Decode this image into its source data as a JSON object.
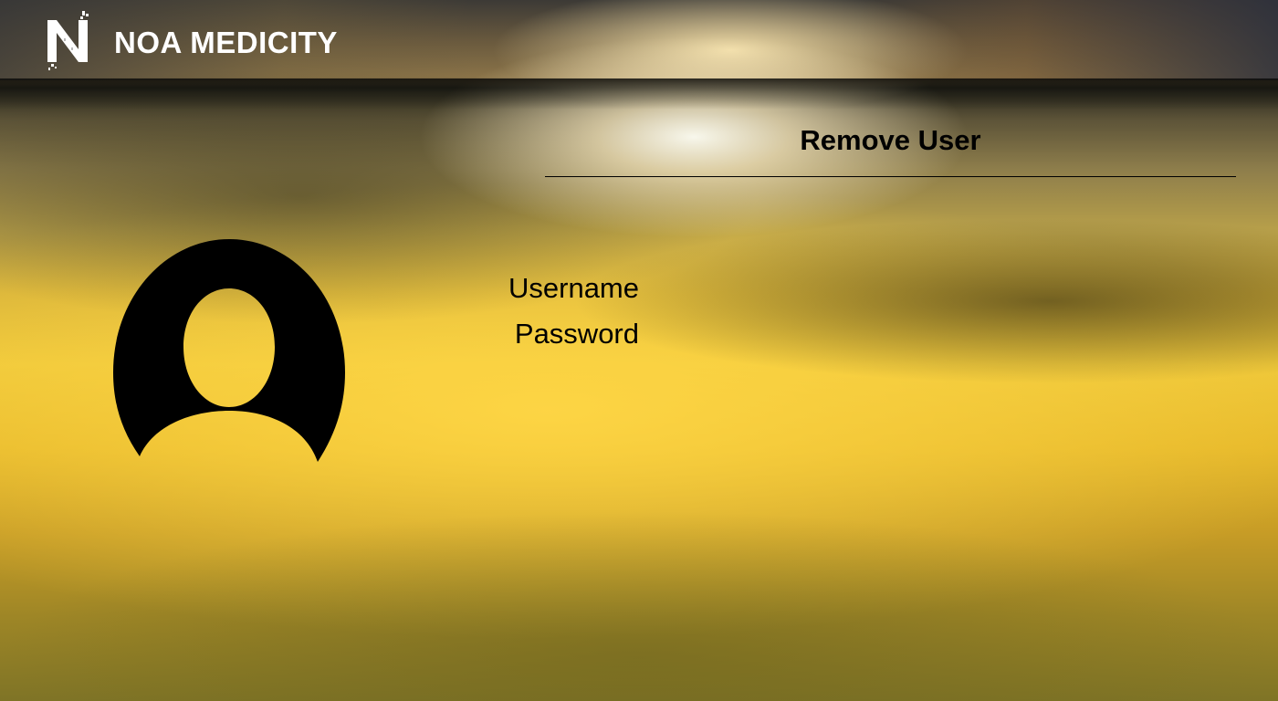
{
  "header": {
    "logo_icon": "noa-medicity-logo-icon",
    "brand_name": "NOA MEDICITY"
  },
  "form": {
    "title": "Remove User",
    "avatar_icon": "user-avatar-icon",
    "username_label": "Username",
    "password_label": "Password"
  },
  "colors": {
    "header_text": "#ffffff",
    "form_text": "#000000"
  }
}
